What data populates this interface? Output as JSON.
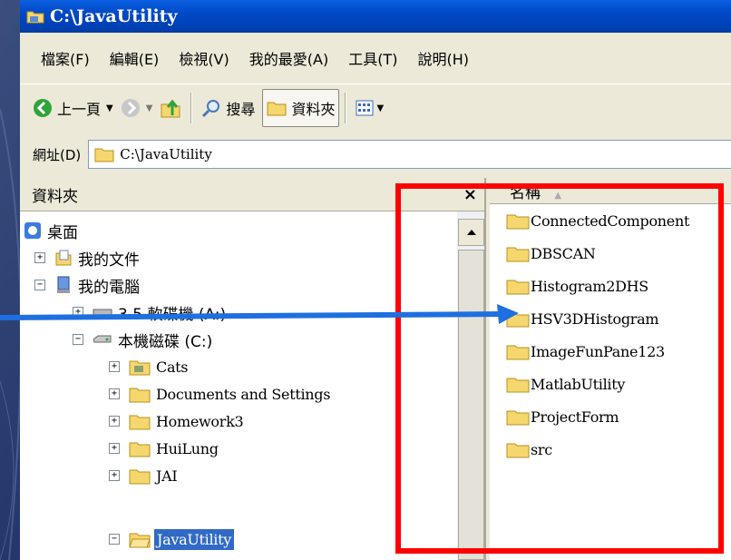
{
  "window": {
    "title": "C:\\JavaUtility"
  },
  "menu": [
    "檔案(F)",
    "編輯(E)",
    "檢視(V)",
    "我的最愛(A)",
    "工具(T)",
    "說明(H)"
  ],
  "toolbar": {
    "back": "上一頁",
    "search": "搜尋",
    "folders": "資料夾"
  },
  "address": {
    "label": "網址(D)",
    "value": "C:\\JavaUtility"
  },
  "folder_pane": {
    "title": "資料夾",
    "close": "×"
  },
  "tree": {
    "desktop": "桌面",
    "mydocs": "我的文件",
    "mycomputer": "我的電腦",
    "floppy": "3.5 軟碟機 (A:)",
    "localdisk": "本機磁碟 (C:)",
    "items": [
      "Cats",
      "Documents and Settings",
      "Homework3",
      "HuiLung",
      "JAI",
      "JavaUtility"
    ]
  },
  "list": {
    "header": "名稱",
    "items": [
      "ConnectedComponent",
      "DBSCAN",
      "Histogram2DHS",
      "HSV3DHistogram",
      "ImageFunPane123",
      "MatlabUtility",
      "ProjectForm",
      "src"
    ]
  },
  "colors": {
    "highlight": "#ff0000",
    "arrow": "#1e6fe0",
    "selection": "#316ac5"
  }
}
